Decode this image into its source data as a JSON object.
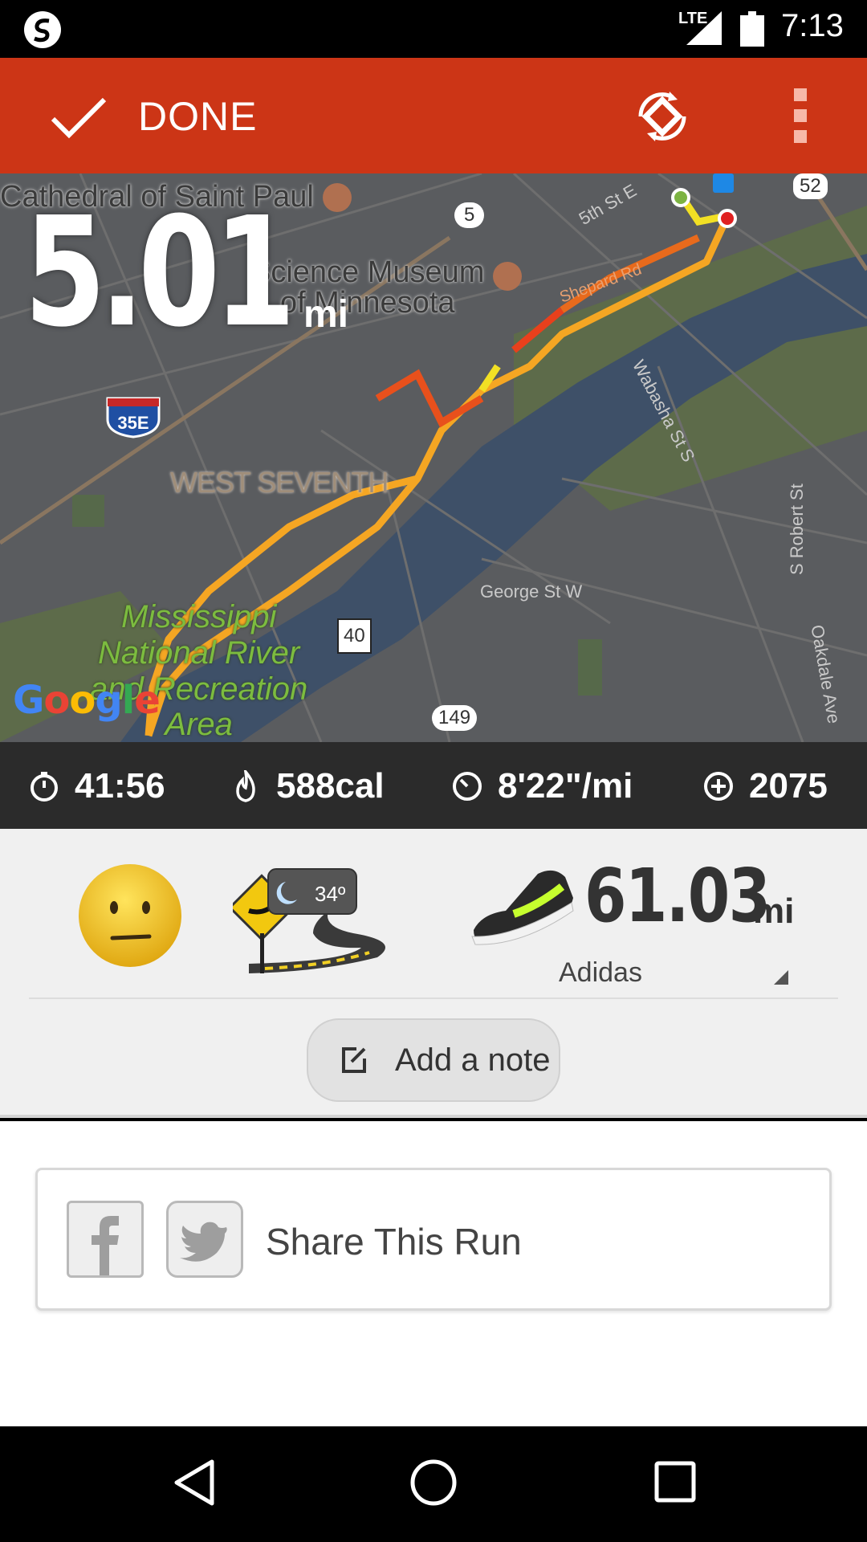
{
  "status_bar": {
    "network": "LTE",
    "time": "7:13"
  },
  "app_bar": {
    "done_label": "DONE"
  },
  "map": {
    "distance_value": "5.01",
    "distance_unit": "mi",
    "labels": {
      "cathedral": "Cathedral of Saint Paul",
      "science_museum_line1": "Science Museum",
      "science_museum_line2": "of Minnesota",
      "west_seventh": "WEST SEVENTH",
      "mississippi_line1": "Mississippi",
      "mississippi_line2": "National River",
      "mississippi_line3": "and Recreation",
      "mississippi_line4": "Area",
      "george_st": "George St W",
      "fifth_st": "5th St E",
      "shepard_rd": "Shepard Rd",
      "wabasha": "Wabasha St S",
      "robert_st": "S Robert St",
      "oakdale": "Oakdale Ave"
    },
    "shields": {
      "hwy5": "5",
      "hwy52": "52",
      "hwy149": "149",
      "hwy40": "40",
      "i35e": "35E"
    },
    "attribution": "Google"
  },
  "stats": {
    "duration": "41:56",
    "calories": "588cal",
    "pace": "8'22\"/mi",
    "fuel": "2075"
  },
  "run_details": {
    "temperature": "34º",
    "shoe_distance": "61.03",
    "shoe_unit": "mi",
    "shoe_name": "Adidas",
    "add_note_label": "Add a note"
  },
  "share": {
    "label": "Share This Run"
  },
  "colors": {
    "app_bar": "#cc3516",
    "route_orange": "#f5a623",
    "route_red": "#e8401c",
    "route_yellow": "#f2e024"
  }
}
